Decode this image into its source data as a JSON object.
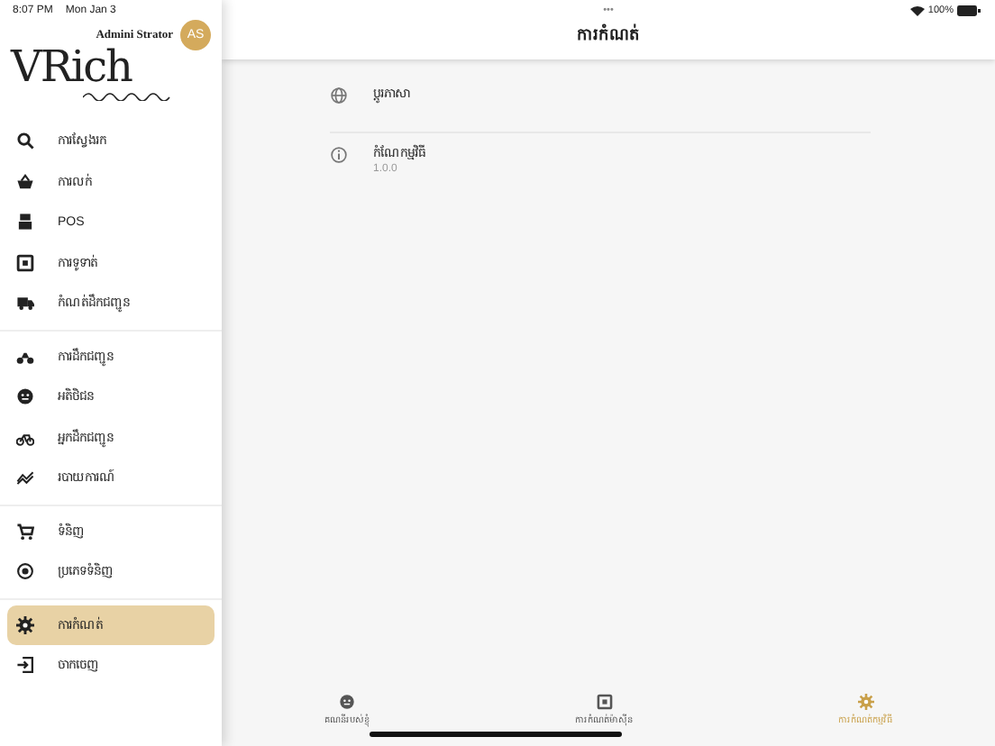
{
  "status_bar": {
    "time": "8:07 PM",
    "date": "Mon Jan 3",
    "dots": "•••",
    "battery": "100%"
  },
  "user": {
    "name": "Admini Strator",
    "initials": "AS"
  },
  "logo": {
    "text": "VRich"
  },
  "sidebar": {
    "groups": [
      {
        "items": [
          {
            "label": "ការស្វែងរក",
            "selected": false
          },
          {
            "label": "ការលក់",
            "selected": false
          },
          {
            "label": "POS",
            "selected": false
          },
          {
            "label": "ការទូទាត់",
            "selected": false
          },
          {
            "label": "កំណត់ដឹកជញ្ជូន",
            "selected": false
          }
        ]
      },
      {
        "items": [
          {
            "label": "ការដឹកជញ្ជូន",
            "selected": false
          },
          {
            "label": "អតិថិជន",
            "selected": false
          },
          {
            "label": "អ្នកដឹកជញ្ជូន",
            "selected": false
          },
          {
            "label": "របាយការណ៍",
            "selected": false
          }
        ]
      },
      {
        "items": [
          {
            "label": "ទំនិញ",
            "selected": false
          },
          {
            "label": "ប្រភេទទំនិញ",
            "selected": false
          }
        ]
      },
      {
        "items": [
          {
            "label": "ការកំណត់",
            "selected": true
          },
          {
            "label": "ចាកចេញ",
            "selected": false
          }
        ]
      }
    ]
  },
  "header": {
    "title": "ការកំណត់"
  },
  "settings": [
    {
      "label": "ប្ដូរភាសា"
    },
    {
      "label": "កំណែកម្មវិធី",
      "value": "1.0.0"
    }
  ],
  "bottom_tabs": [
    {
      "label": "គណនីរបស់ខ្ញុំ",
      "selected": false
    },
    {
      "label": "ការកំណត់ម៉ាស៊ីន",
      "selected": false
    },
    {
      "label": "ការកំណត់កម្មវិធី",
      "selected": true
    }
  ]
}
